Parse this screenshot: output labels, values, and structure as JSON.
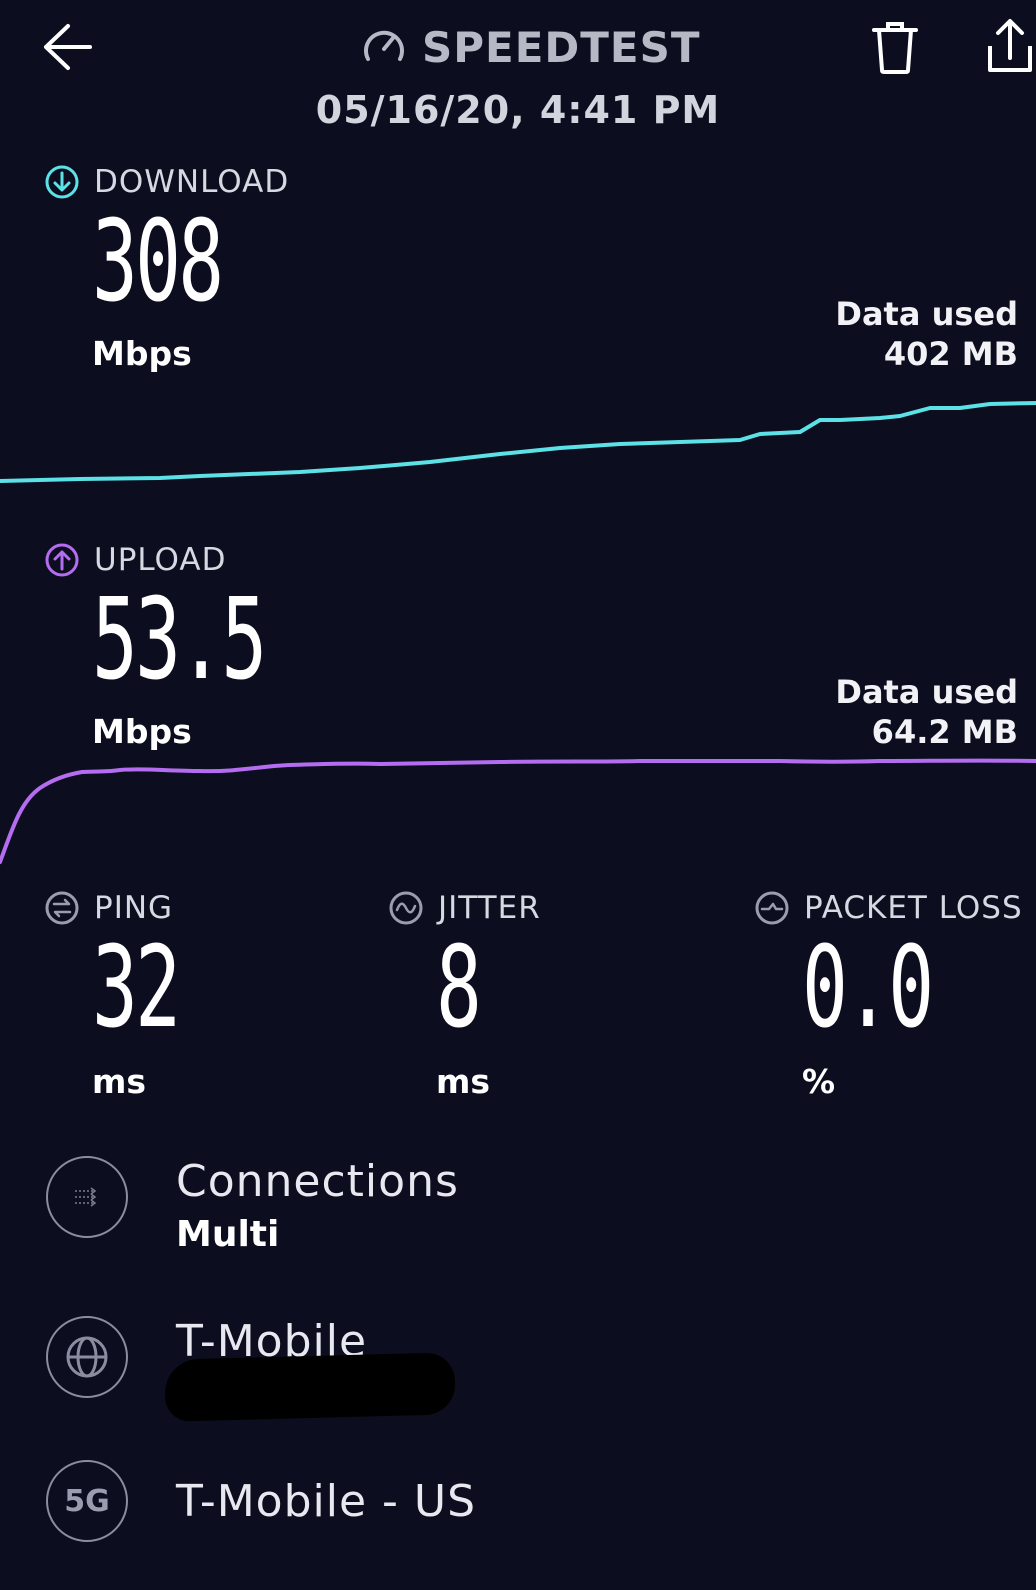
{
  "header": {
    "title": "SPEEDTEST",
    "timestamp": "05/16/20, 4:41 PM"
  },
  "download": {
    "label": "DOWNLOAD",
    "value": "308",
    "unit": "Mbps",
    "data_used_label": "Data used",
    "data_used_value": "402 MB",
    "color": "#5ce1e6"
  },
  "upload": {
    "label": "UPLOAD",
    "value": "53.5",
    "unit": "Mbps",
    "data_used_label": "Data used",
    "data_used_value": "64.2 MB",
    "color": "#b46cf0"
  },
  "stats": {
    "ping": {
      "label": "PING",
      "value": "32",
      "unit": "ms"
    },
    "jitter": {
      "label": "JITTER",
      "value": "8",
      "unit": "ms"
    },
    "packet_loss": {
      "label": "PACKET LOSS",
      "value": "0.0",
      "unit": "%"
    }
  },
  "info": {
    "connections": {
      "title": "Connections",
      "value": "Multi",
      "icon": "connections-icon"
    },
    "isp": {
      "title": "T-Mobile",
      "icon": "globe-icon"
    },
    "server": {
      "title": "T-Mobile - US",
      "badge": "5G"
    }
  }
}
